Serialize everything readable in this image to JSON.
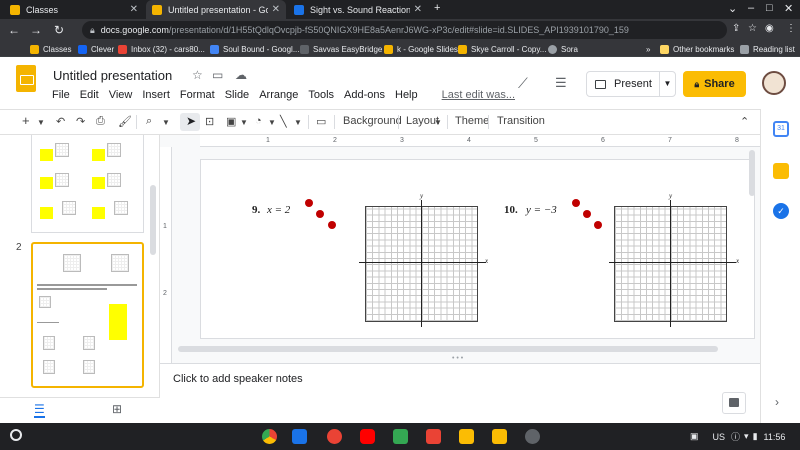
{
  "browser": {
    "tabs": [
      {
        "title": "Classes",
        "favicon_color": "#f4b400",
        "active": false
      },
      {
        "title": "Untitled presentation - Google Sl",
        "favicon_color": "#f4b400",
        "active": true
      },
      {
        "title": "Sight vs. Sound Reactions Gizm",
        "favicon_color": "#1a73e8",
        "active": false
      }
    ],
    "new_tab": "+",
    "url_host": "docs.google.com",
    "url_path": "/presentation/d/1H55tQdlqOvcpjb-fS50QNIGX9HE8a5AenrJ6WG-xP3c/edit#slide=id.SLIDES_API1939101790_159",
    "bookmarks": [
      {
        "label": "Classes",
        "color": "#f4b400"
      },
      {
        "label": "Clever",
        "color": "#1464f4"
      },
      {
        "label": "Inbox (32) - cars80...",
        "color": "#ea4335"
      },
      {
        "label": "Soul Bound - Googl...",
        "color": "#4285f4"
      },
      {
        "label": "Savvas EasyBridge",
        "color": "#5f6368"
      },
      {
        "label": "k - Google Slides",
        "color": "#f4b400"
      },
      {
        "label": "Skye Carroll - Copy...",
        "color": "#f4b400"
      },
      {
        "label": "Sora",
        "color": "#9aa0a6"
      }
    ],
    "other_bookmarks": "Other bookmarks",
    "reading_list": "Reading list",
    "more": "»"
  },
  "slides": {
    "title": "Untitled presentation",
    "menu": [
      "File",
      "Edit",
      "View",
      "Insert",
      "Format",
      "Slide",
      "Arrange",
      "Tools",
      "Add-ons",
      "Help"
    ],
    "last_edit": "Last edit was...",
    "present_label": "Present",
    "share_label": "Share"
  },
  "toolbar": {
    "background": "Background",
    "layout": "Layout",
    "theme": "Theme",
    "transition": "Transition"
  },
  "filmstrip": {
    "slide_number": "2"
  },
  "ruler": {
    "top_ticks": [
      "1",
      "2",
      "3",
      "4",
      "5",
      "6",
      "7",
      "8"
    ],
    "left_ticks": [
      "1",
      "2"
    ]
  },
  "slide": {
    "problems": [
      {
        "number": "9.",
        "equation": "x = 2"
      },
      {
        "number": "10.",
        "equation": "y = −3"
      }
    ],
    "axis_x": "x",
    "axis_y": "y"
  },
  "notes": {
    "placeholder": "Click to add speaker notes"
  },
  "shelf": {
    "locale": "US",
    "time": "11:56"
  },
  "colors": {
    "accent": "#fbbc04",
    "dot": "#c00000",
    "highlight": "#ffff00"
  }
}
